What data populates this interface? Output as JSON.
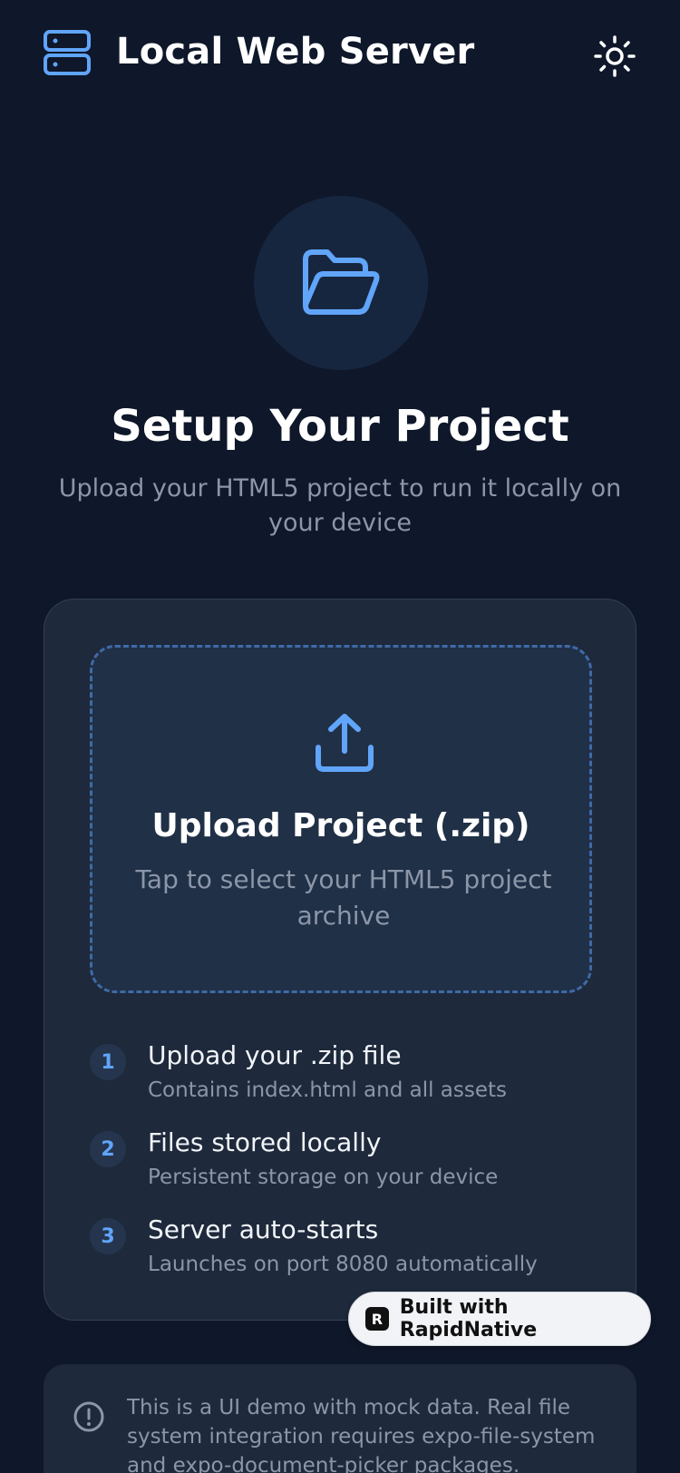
{
  "header": {
    "title": "Local Web Server",
    "app_icon": "server-icon",
    "theme_toggle_icon": "sun-icon"
  },
  "hero": {
    "icon": "folder-open-icon",
    "title": "Setup Your Project",
    "subtitle": "Upload your HTML5 project to run it locally on your device"
  },
  "upload": {
    "icon": "upload-icon",
    "title": "Upload Project (.zip)",
    "subtitle": "Tap to select your HTML5 project archive"
  },
  "steps": [
    {
      "number": "1",
      "title": "Upload your .zip file",
      "subtitle": "Contains index.html and all assets"
    },
    {
      "number": "2",
      "title": "Files stored locally",
      "subtitle": "Persistent storage on your device"
    },
    {
      "number": "3",
      "title": "Server auto-starts",
      "subtitle": "Launches on port 8080 automatically"
    }
  ],
  "badge": {
    "label": "Built with RapidNative",
    "logo": "R"
  },
  "notice": {
    "icon": "info-circle-icon",
    "text": "This is a UI demo with mock data. Real file system integration requires expo-file-system and expo-document-picker packages."
  },
  "colors": {
    "background": "#0f172a",
    "card": "#1e293b",
    "accent": "#60a5fa",
    "muted_text": "#8b96a8"
  }
}
